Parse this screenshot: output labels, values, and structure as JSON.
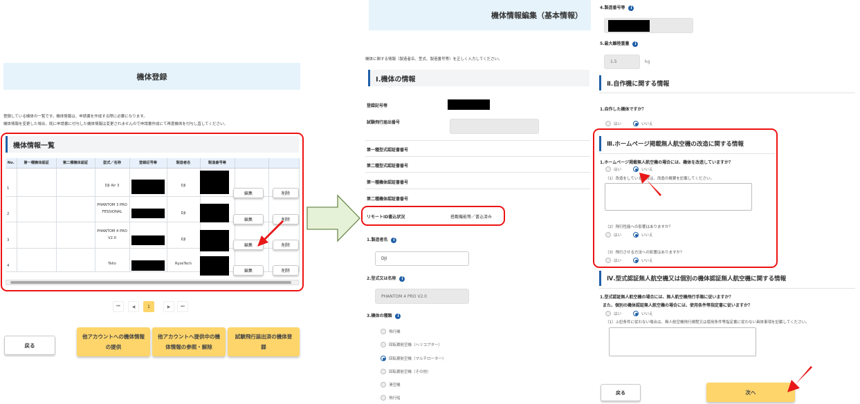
{
  "left": {
    "title": "機体登録",
    "desc_line1": "登録している機体の一覧です。機体情報は、申請書を作成する際に必要になります。",
    "desc_line2": "機体情報を変更した場合、既に申請書に付与した機体情報は変更されませんので申請書作成にて再度機体を付与し直してください。",
    "list_title": "機体情報一覧",
    "columns": [
      "No.",
      "第一種機体認証",
      "第二種機体認証",
      "型式／名称",
      "登録記号等",
      "製造者名",
      "製造番号等",
      "",
      ""
    ],
    "rows": [
      {
        "no": "1",
        "model": "DJI Air 3",
        "maker": "DJI",
        "edit": "編集",
        "delete": "削除"
      },
      {
        "no": "2",
        "model": "PHANTOM 3 PROFESSIONAL",
        "maker": "DJI",
        "edit": "編集",
        "delete": "削除"
      },
      {
        "no": "3",
        "model": "PHANTOM 4 PRO V2.0",
        "maker": "DJI",
        "edit": "編集",
        "delete": "削除"
      },
      {
        "no": "4",
        "model": "Tello",
        "maker": "RyzeTech",
        "edit": "編集",
        "delete": "削除"
      }
    ],
    "pager": {
      "first": "⏮",
      "prev": "◀",
      "current": "1",
      "next": "▶",
      "last": "⏭"
    },
    "back": "戻る",
    "btn1": "他アカウントへの機体情報の提供",
    "btn2": "他アカウントへ提供中の機体情報の参照・解除",
    "btn3": "試験飛行届出済の機体登録"
  },
  "mid": {
    "title": "機体情報編集（基本情報）",
    "desc": "機体に関する情報（製造者名、型式、製造番号等）を正しく入力してください。",
    "section1": "Ⅰ.機体の情報",
    "reg_label": "登録記号等",
    "trial_label": "試験飛行届出番号",
    "cert1_type": "第一種型式認証書番号",
    "cert2_type": "第二種型式認証書番号",
    "cert1_body": "第一種機体認証書番号",
    "cert2_body": "第二種機体認証書番号",
    "remote_label": "リモートID書込状況",
    "remote_value": "搭載機能等／書込済み",
    "maker_label": "1.製造者名",
    "maker_value": "DJI",
    "model_label": "2.型式又は名称",
    "model_value": "PHANTOM 4 PRO V2.0",
    "kind_label": "3.機体の種類",
    "kinds": [
      "飛行機",
      "回転翼航空機（ヘリコプター）",
      "回転翼航空機（マルチローター）",
      "回転翼航空機（その他）",
      "滑空機",
      "飛行船"
    ],
    "kind_selected": 2
  },
  "right": {
    "serial_label": "4.製造番号等",
    "weight_label": "5.最大離陸重量",
    "weight_value": "1.5",
    "weight_unit": "kg",
    "section2": "Ⅱ.自作機に関する情報",
    "q_self": "1.自作した機体ですか？",
    "yes": "はい",
    "no": "いいえ",
    "section3": "Ⅲ.ホームページ掲載無人航空機の改造に関する情報",
    "q_hp": "1.ホームページ掲載無人航空機の場合には、機体を改造していますか？",
    "q_hp_sub1": "（1）改造をしている場合は、改造の概要を記載してください。",
    "q_hp_sub2": "（2）飛行性能への影響はありますか？",
    "q_hp_sub3": "（3）飛行させる方法への影響はありますか？",
    "section4": "Ⅳ.型式認証無人航空機又は個別の機体認証無人航空機に関する情報",
    "q_cert1": "1.型式認証無人航空機の場合には、無人航空機飛行手順に従いますか？",
    "q_cert2": "また、個別の機体認証無人航空機の場合には、使用条件等指定書に従いますか？",
    "q_cert_sub": "（1）上記条件に従わない場合は、無人航空機飛行規程又は使用条件等指定書に従わない具体事項を記載してください。",
    "back": "戻る",
    "next": "次へ"
  },
  "colors": {
    "accent": "#fdd56b",
    "header_bg": "#e6f3fb",
    "highlight": "#e11111",
    "brand": "#1f5fa8"
  }
}
